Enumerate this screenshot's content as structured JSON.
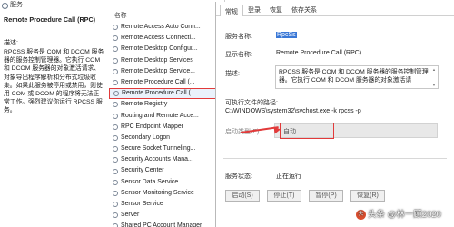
{
  "services_window": {
    "title": "服务",
    "detail": {
      "name": "Remote Procedure Call (RPC)",
      "desc_label": "描述:",
      "desc": "RPCSS 服务是 COM 和 DCOM 服务器的服务控制管理器。它执行 COM 和 DCOM 服务器的对象激活请求、对象导出程序解析和分布式垃圾收集。如果此服务被停用或禁用，则使用 COM 或 DCOM 的程序将无法正常工作。强烈建议你运行 RPCSS 服务。"
    },
    "list_header": "名称",
    "rows": [
      "Remote Access Auto Conn...",
      "Remote Access Connecti...",
      "Remote Desktop Configur...",
      "Remote Desktop Services",
      "Remote Desktop Service...",
      "Remote Procedure Call (...",
      "Remote Procedure Call (...",
      "Remote Registry",
      "Routing and Remote Acce...",
      "RPC Endpoint Mapper",
      "Secondary Logon",
      "Secure Socket Tunneling...",
      "Security Accounts Mana...",
      "Security Center",
      "Sensor Data Service",
      "Sensor Monitoring Service",
      "Sensor Service",
      "Server",
      "Shared PC Account Manager"
    ],
    "selected_index": 6
  },
  "properties": {
    "tabs": [
      "常规",
      "登录",
      "恢复",
      "依存关系"
    ],
    "service_name_label": "服务名称:",
    "service_name_value": "RpcSs",
    "display_name_label": "显示名称:",
    "display_name_value": "Remote Procedure Call (RPC)",
    "desc_label": "描述:",
    "desc_value": "RPCSS 服务是 COM 和 DCOM 服务器的服务控制管理器。它执行 COM 和 DCOM 服务器的对象激活请",
    "exe_label": "可执行文件的路径:",
    "exe_path": "C:\\WINDOWS\\system32\\svchost.exe -k rpcss -p",
    "startup_label": "启动类型(E):",
    "startup_value": "自动",
    "status_label": "服务状态:",
    "status_value": "正在运行",
    "buttons": [
      "启动(S)",
      "停止(T)",
      "暂停(P)",
      "恢复(R)"
    ]
  },
  "colors": {
    "highlight": "#e23a3a",
    "selection": "#3a78d6"
  },
  "watermark": {
    "text": "头条 @林一顾2020",
    "badge": "头"
  }
}
